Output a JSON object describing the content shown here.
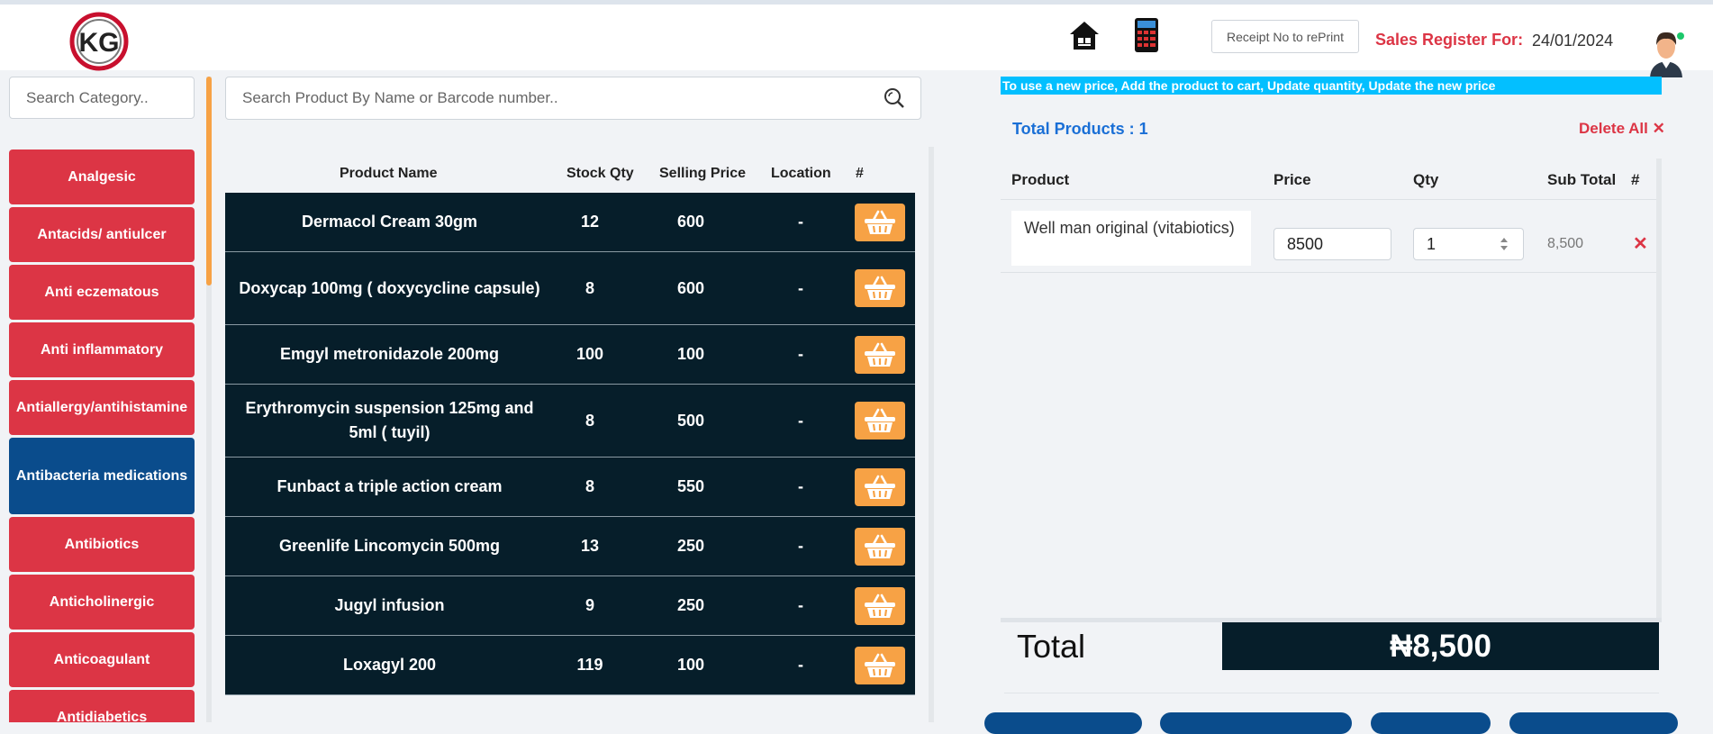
{
  "header": {
    "logo_text": "KG",
    "receipt_button": "Receipt No to rePrint",
    "sales_label": "Sales Register For:",
    "sales_date": "24/01/2024",
    "icons": [
      "home-icon",
      "calculator-icon",
      "avatar"
    ]
  },
  "categories": {
    "search_placeholder": "Search Category..",
    "items": [
      {
        "label": "Analgesic",
        "active": false
      },
      {
        "label": "Antacids/ antiulcer",
        "active": false
      },
      {
        "label": "Anti eczematous",
        "active": false
      },
      {
        "label": "Anti inflammatory",
        "active": false
      },
      {
        "label": "Antiallergy/antihistamine",
        "active": false
      },
      {
        "label": "Antibacteria medications",
        "active": true
      },
      {
        "label": "Antibiotics",
        "active": false
      },
      {
        "label": "Anticholinergic",
        "active": false
      },
      {
        "label": "Anticoagulant",
        "active": false
      },
      {
        "label": "Antidiabetics",
        "active": false
      }
    ]
  },
  "products": {
    "search_placeholder": "Search Product By Name or Barcode number..",
    "columns": [
      "Product Name",
      "Stock Qty",
      "Selling Price",
      "Location",
      "#"
    ],
    "rows": [
      {
        "name": "Dermacol Cream 30gm",
        "stock": "12",
        "price": "600",
        "location": "-"
      },
      {
        "name": "Doxycap 100mg ( doxycycline capsule)",
        "stock": "8",
        "price": "600",
        "location": "-"
      },
      {
        "name": "Emgyl metronidazole 200mg",
        "stock": "100",
        "price": "100",
        "location": "-"
      },
      {
        "name": "Erythromycin suspension 125mg and 5ml ( tuyil)",
        "stock": "8",
        "price": "500",
        "location": "-"
      },
      {
        "name": "Funbact a triple action cream",
        "stock": "8",
        "price": "550",
        "location": "-"
      },
      {
        "name": "Greenlife Lincomycin 500mg",
        "stock": "13",
        "price": "250",
        "location": "-"
      },
      {
        "name": "Jugyl infusion",
        "stock": "9",
        "price": "250",
        "location": "-"
      },
      {
        "name": "Loxagyl 200",
        "stock": "119",
        "price": "100",
        "location": "-"
      }
    ]
  },
  "cart": {
    "notice": "To use a new price, Add the product to cart, Update quantity, Update the new price",
    "total_products": "Total Products : 1",
    "delete_all": "Delete All",
    "columns": [
      "Product",
      "Price",
      "Qty",
      "Sub Total",
      "#"
    ],
    "rows": [
      {
        "product": "Well man original (vitabiotics)",
        "price": "8500",
        "qty": "1",
        "subtotal": "8,500"
      }
    ],
    "total_label": "Total",
    "total_value": "₦8,500"
  },
  "colors": {
    "category_red": "#dc3545",
    "category_active": "#0a4c8c",
    "table_dark": "#061e2a",
    "accent_orange": "#f7a245",
    "notice_blue": "#03bfff",
    "link_blue": "#1a6fd6"
  }
}
